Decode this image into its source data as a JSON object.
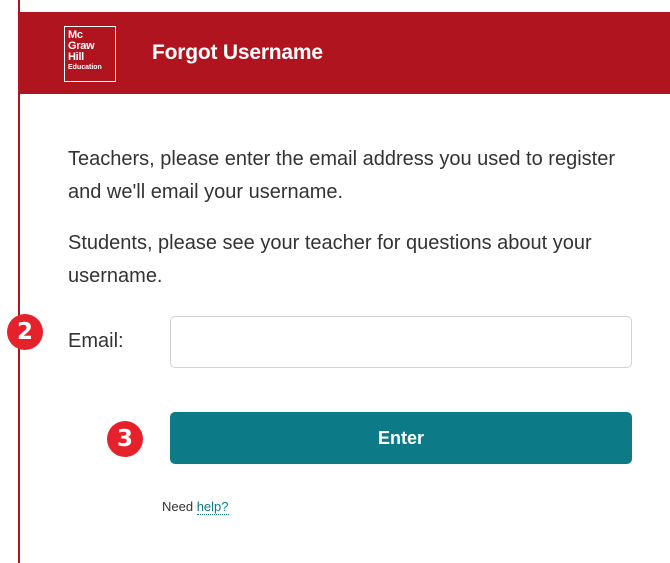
{
  "header": {
    "logo_lines": [
      "Mc",
      "Graw",
      "Hill",
      "Education"
    ],
    "title": "Forgot Username"
  },
  "instructions": {
    "teachers": "Teachers, please enter the email address you used to register and we'll email your username.",
    "students": "Students, please see your teacher for questions about your username."
  },
  "form": {
    "email_label": "Email:",
    "email_value": "",
    "email_placeholder": "",
    "submit_label": "Enter"
  },
  "help": {
    "prefix": "Need",
    "link_text": "help?"
  },
  "step_badges": {
    "email_step": "2",
    "submit_step": "3"
  },
  "colors": {
    "header_bg": "#b0151f",
    "button_bg": "#0d7a87",
    "badge_bg": "#e5212c",
    "link": "#0d7a87"
  }
}
